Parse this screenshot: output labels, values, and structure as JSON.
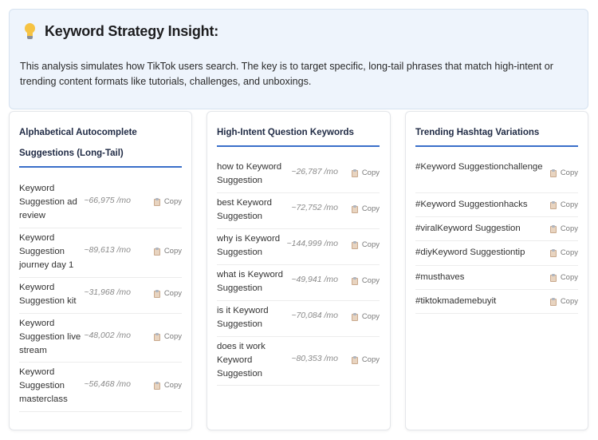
{
  "insight": {
    "icon": "lightbulb-icon",
    "title": "Keyword Strategy Insight:",
    "text": "This analysis simulates how TikTok users search. The key is to target specific, long-tail phrases that match high-intent or trending content formats like tutorials, challenges, and unboxings."
  },
  "cards": [
    {
      "title": "Alphabetical Autocomplete Suggestions (Long-Tail)",
      "items": [
        {
          "keyword": "Keyword Suggestion ad review",
          "volume": "~66,975 /mo",
          "copy": "Copy"
        },
        {
          "keyword": "Keyword Suggestion journey day 1",
          "volume": "~89,613 /mo",
          "copy": "Copy"
        },
        {
          "keyword": "Keyword Suggestion kit",
          "volume": "~31,968 /mo",
          "copy": "Copy"
        },
        {
          "keyword": "Keyword Suggestion live stream",
          "volume": "~48,002 /mo",
          "copy": "Copy"
        },
        {
          "keyword": "Keyword Suggestion masterclass",
          "volume": "~56,468 /mo",
          "copy": "Copy"
        }
      ]
    },
    {
      "title": "High-Intent Question Keywords",
      "items": [
        {
          "keyword": "how to Keyword Suggestion",
          "volume": "~26,787 /mo",
          "copy": "Copy"
        },
        {
          "keyword": "best Keyword Suggestion",
          "volume": "~72,752 /mo",
          "copy": "Copy"
        },
        {
          "keyword": "why is Keyword Suggestion",
          "volume": "~144,999 /mo",
          "copy": "Copy"
        },
        {
          "keyword": "what is Keyword Suggestion",
          "volume": "~49,941 /mo",
          "copy": "Copy"
        },
        {
          "keyword": "is it Keyword Suggestion",
          "volume": "~70,084 /mo",
          "copy": "Copy"
        },
        {
          "keyword": "does it work Keyword Suggestion",
          "volume": "~80,353 /mo",
          "copy": "Copy"
        }
      ]
    },
    {
      "title": "Trending Hashtag Variations",
      "items": [
        {
          "keyword": "#Keyword Suggestionchallenge",
          "copy": "Copy"
        },
        {
          "keyword": "#Keyword Suggestionhacks",
          "copy": "Copy"
        },
        {
          "keyword": "#viralKeyword Suggestion",
          "copy": "Copy"
        },
        {
          "keyword": "#diyKeyword Suggestiontip",
          "copy": "Copy"
        },
        {
          "keyword": "#musthaves",
          "copy": "Copy"
        },
        {
          "keyword": "#tiktokmademebuyit",
          "copy": "Copy"
        }
      ]
    }
  ]
}
